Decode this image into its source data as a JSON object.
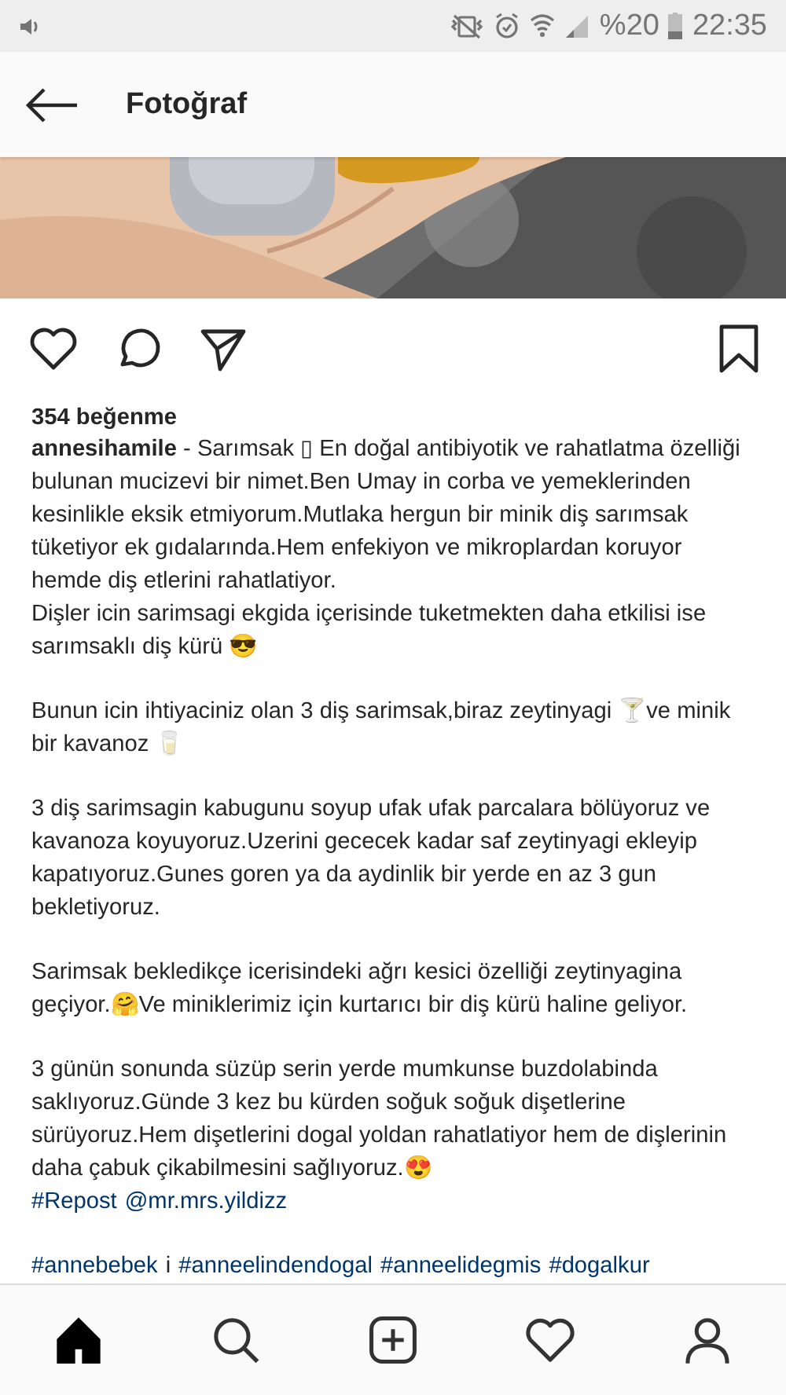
{
  "status_bar": {
    "battery_text": "%20",
    "time": "22:35"
  },
  "toolbar": {
    "title": "Fotoğraf"
  },
  "post": {
    "actions": [
      {
        "kind": "like"
      },
      {
        "kind": "comment"
      },
      {
        "kind": "share"
      },
      {
        "kind": "save"
      }
    ],
    "likes": "354 beğenme",
    "caption": [
      "**annesihamile** - Sarımsak ▯ En doğal antibiyotik ve rahatlatma özelliği bulunan mucizevi bir nimet.Ben Umay in corba ve yemeklerinden kesinlikle eksik etmiyorum.Mutlaka hergun bir minik diş sarımsak tüketiyor ek gıdalarında.Hem enfekiyon ve mikroplardan koruyor hemde diş etlerini rahatlatiyor.\nDişler icin sarimsagi ekgida içerisinde tuketmekten daha etkilisi ise sarımsaklı diş kürü 😎",
      "Bunun icin ihtiyaciniz olan 3 diş sarimsak,biraz zeytinyagi 🍸ve minik bir kavanoz 🥛",
      "3 diş sarimsagin kabugunu  soyup ufak ufak parcalara bölüyoruz ve kavanoza koyuyoruz.Uzerini gececek kadar saf zeytinyagi ekleyip kapatıyoruz.Gunes goren ya da aydinlik bir yerde en az 3 gun bekletiyoruz.",
      "Sarimsak bekledikçe icerisindeki ağrı kesici özelliği zeytinyagina geçiyor.🤗Ve miniklerimiz için kurtarıcı bir diş kürü haline geliyor.",
      "3 günün sonunda süzüp serin yerde mumkunse buzdolabinda saklıyoruz.Günde 3 kez bu kürden soğuk  soğuk dişetlerine sürüyoruz.Hem dişetlerini dogal yoldan rahatlatiyor hem de dişlerinin daha çabuk çikabilmesini sağlıyoruz.😍"
    ],
    "repost": [
      {
        "kind": "link",
        "text": "#Repost"
      },
      {
        "kind": "link",
        "text": "@mr.mrs.yildizz"
      }
    ],
    "hashtags": [
      {
        "kind": "link",
        "text": "#annebebek"
      },
      {
        "kind": "text",
        "text": "i"
      },
      {
        "kind": "link",
        "text": "#anneelindendogal"
      },
      {
        "kind": "link",
        "text": "#anneelidegmis"
      },
      {
        "kind": "link",
        "text": "#dogalkur"
      }
    ]
  },
  "bottom_nav": [
    {
      "kind": "home",
      "selected": true
    },
    {
      "kind": "search",
      "selected": false
    },
    {
      "kind": "add",
      "selected": false
    },
    {
      "kind": "activity",
      "selected": false
    },
    {
      "kind": "profile",
      "selected": false
    }
  ]
}
